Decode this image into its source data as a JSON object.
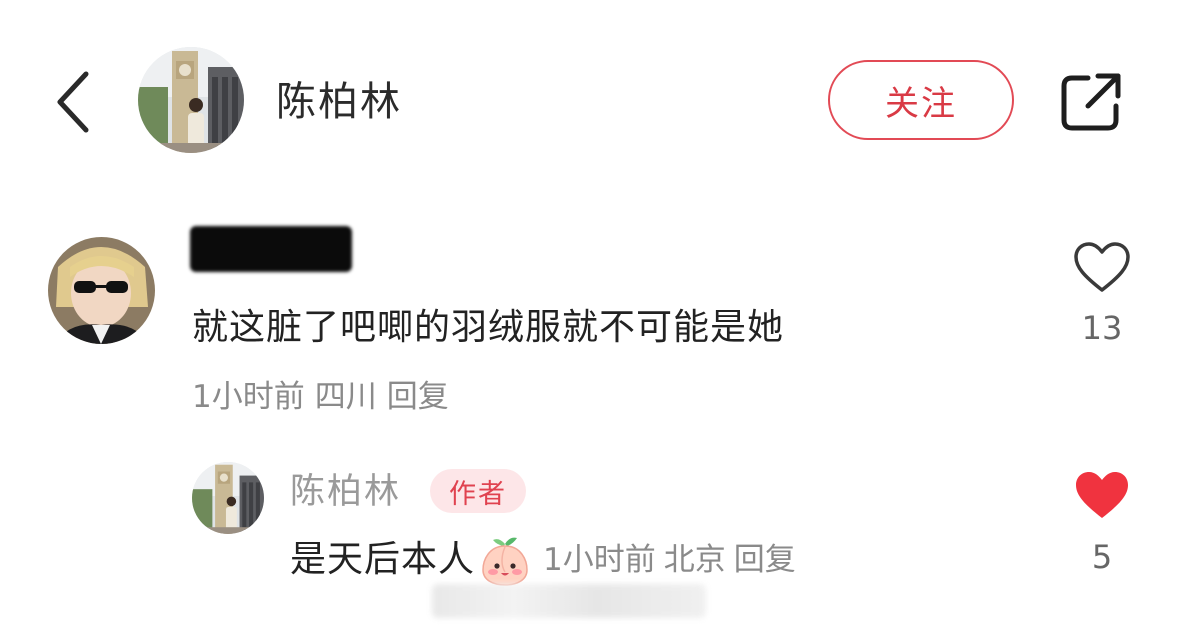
{
  "header": {
    "author_name": "陈柏林",
    "follow_label": "关注",
    "icons": {
      "back": "chevron-left-icon",
      "share": "share-icon"
    }
  },
  "comment": {
    "text": "就这脏了吧唧的羽绒服就不可能是她",
    "time": "1小时前",
    "location": "四川",
    "reply_label": "回复",
    "like_count": "13",
    "liked": false
  },
  "reply": {
    "author_name": "陈柏林",
    "author_tag": "作者",
    "text": "是天后本人",
    "emoji": "smiling-peach-emoji",
    "time": "1小时前",
    "location": "北京",
    "reply_label": "回复",
    "like_count": "5",
    "liked": true
  },
  "colors": {
    "accent": "#e24a55",
    "like_active": "#f0333f",
    "tag_bg": "#fde6e8",
    "meta_text": "#8a8a8a"
  }
}
